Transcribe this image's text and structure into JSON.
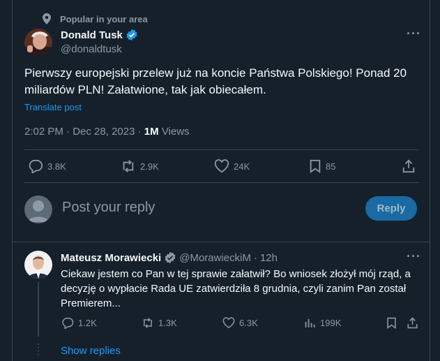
{
  "context": {
    "label": "Popular in your area"
  },
  "post": {
    "author_name": "Donald Tusk",
    "author_handle": "@donaldtusk",
    "text": "Pierwszy europejski przelew już na koncie Państwa Polskiego! Ponad 20 miliardów PLN! Załatwione, tak jak obiecałem.",
    "translate": "Translate post",
    "time": "2:02 PM",
    "date": "Dec 28, 2023",
    "views_count": "1M",
    "views_label": "Views",
    "sep": "·",
    "actions": {
      "replies": "3.8K",
      "reposts": "2.9K",
      "likes": "24K",
      "bookmarks": "85"
    }
  },
  "compose": {
    "placeholder": "Post your reply",
    "button": "Reply"
  },
  "reply": {
    "author_name": "Mateusz Morawiecki",
    "author_handle": "@MorawieckiM",
    "time": "12h",
    "sep": "·",
    "text": "Ciekaw jestem co Pan w tej sprawie załatwił? Bo wniosek złożył mój rząd, a decyzję o wypłacie Rada UE zatwierdziła 8 grudnia, czyli zanim Pan został Premierem...",
    "actions": {
      "replies": "1.2K",
      "reposts": "1.3K",
      "likes": "6.3K",
      "views": "199K"
    },
    "show_replies": "Show replies"
  },
  "colors": {
    "background": "#15202b",
    "accent": "#1d9bf0",
    "muted": "#8b98a5",
    "border": "#38444d"
  },
  "icons": [
    "location-pin-icon",
    "verified-badge-icon",
    "more-icon",
    "reply-icon",
    "repost-icon",
    "like-icon",
    "bookmark-icon",
    "share-icon",
    "views-icon"
  ]
}
